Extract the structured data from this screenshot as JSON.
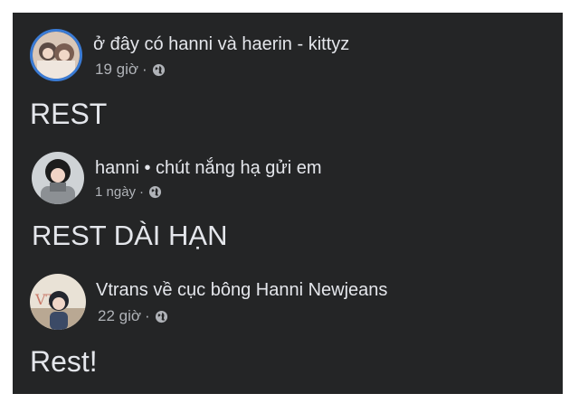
{
  "posts": [
    {
      "name": "ở đây có hanni và haerin - kittyz",
      "time": "19 giờ",
      "separator": "·",
      "privacy_icon": "globe-icon",
      "text": "REST"
    },
    {
      "name": "hanni • chút nắng hạ gửi em",
      "time": "1 ngày",
      "separator": "·",
      "privacy_icon": "globe-icon",
      "text": "REST DÀI HẠN"
    },
    {
      "name": "Vtrans về cục bông Hanni Newjeans",
      "time": "22 giờ",
      "separator": "·",
      "privacy_icon": "globe-icon",
      "text": "Rest!"
    }
  ],
  "colors": {
    "background": "#242526",
    "primary_text": "#e4e6eb",
    "secondary_text": "#b0b3b8",
    "story_ring": "#3a7bd5"
  }
}
